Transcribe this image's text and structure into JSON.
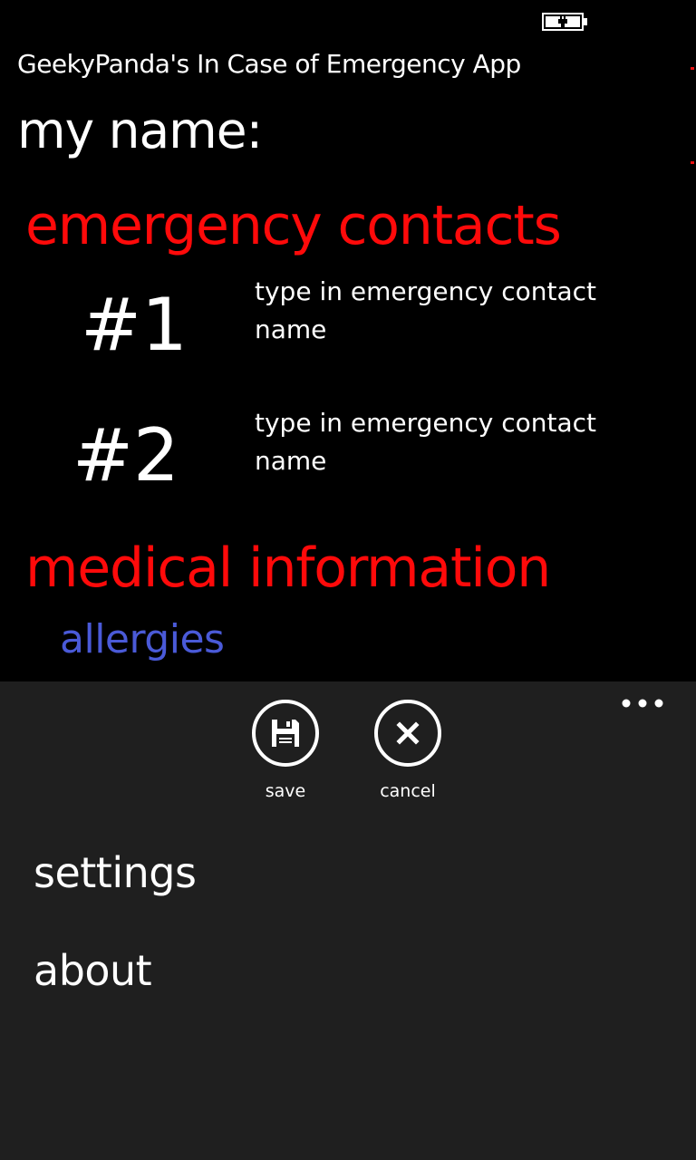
{
  "status_bar": {
    "battery_icon": "battery-charging-icon"
  },
  "header": {
    "app_title": "GeekyPanda's In Case of Emergency App",
    "name_label": "my name:"
  },
  "emergency_contacts": {
    "title": "emergency contacts",
    "contacts": [
      {
        "number": "#1",
        "placeholder": "type in emergency contact name"
      },
      {
        "number": "#2",
        "placeholder": "type in emergency contact name"
      }
    ]
  },
  "medical_information": {
    "title": "medical information",
    "allergies_label": "allergies"
  },
  "app_bar": {
    "more_icon": "ellipsis-icon",
    "buttons": [
      {
        "label": "save",
        "icon": "save-icon"
      },
      {
        "label": "cancel",
        "icon": "cancel-icon"
      }
    ],
    "menu_items": [
      {
        "label": "settings"
      },
      {
        "label": "about"
      }
    ]
  },
  "colors": {
    "background": "#000000",
    "app_bar_background": "#1f1f1f",
    "section_title": "#ff0a0a",
    "allergies_link": "#4a5ad8",
    "text": "#ffffff"
  }
}
